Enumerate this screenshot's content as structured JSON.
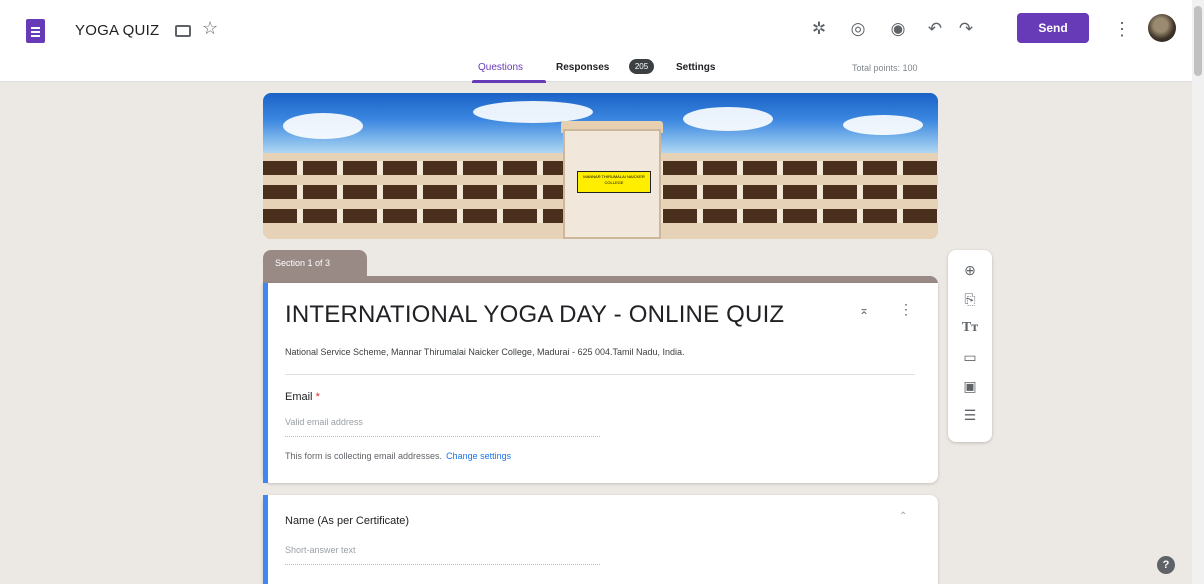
{
  "header": {
    "doc_title": "YOGA QUIZ",
    "send_label": "Send",
    "icons": [
      "customize-theme-icon",
      "palette-icon",
      "preview-eye-icon",
      "undo-icon",
      "redo-icon"
    ]
  },
  "tabs": {
    "questions": "Questions",
    "responses": "Responses",
    "responses_count": "205",
    "settings": "Settings",
    "total_points": "Total points: 100"
  },
  "banner": {
    "signboard_text": "MANNAR THIRUMALAI NAICKER COLLEGE"
  },
  "section": {
    "label": "Section 1 of 3"
  },
  "form": {
    "title": "INTERNATIONAL YOGA DAY - ONLINE QUIZ",
    "description": "National Service Scheme, Mannar Thirumalai Naicker College, Madurai - 625 004.Tamil Nadu, India.",
    "email_label": "Email",
    "email_required_mark": "*",
    "email_placeholder": "Valid email address",
    "collect_note": "This form is collecting email addresses.",
    "collect_link": "Change settings"
  },
  "question2": {
    "title": "Name (As per Certificate)",
    "placeholder": "Short-answer text"
  },
  "toolbar": {
    "icons": [
      "add-question-icon",
      "import-questions-icon",
      "add-title-icon",
      "add-image-icon",
      "add-video-icon",
      "add-section-icon"
    ]
  },
  "colors": {
    "brand_purple": "#673ab7",
    "accent_blue": "#4285f4",
    "section_tab": "#9a8a86",
    "background": "#ece9e4"
  }
}
